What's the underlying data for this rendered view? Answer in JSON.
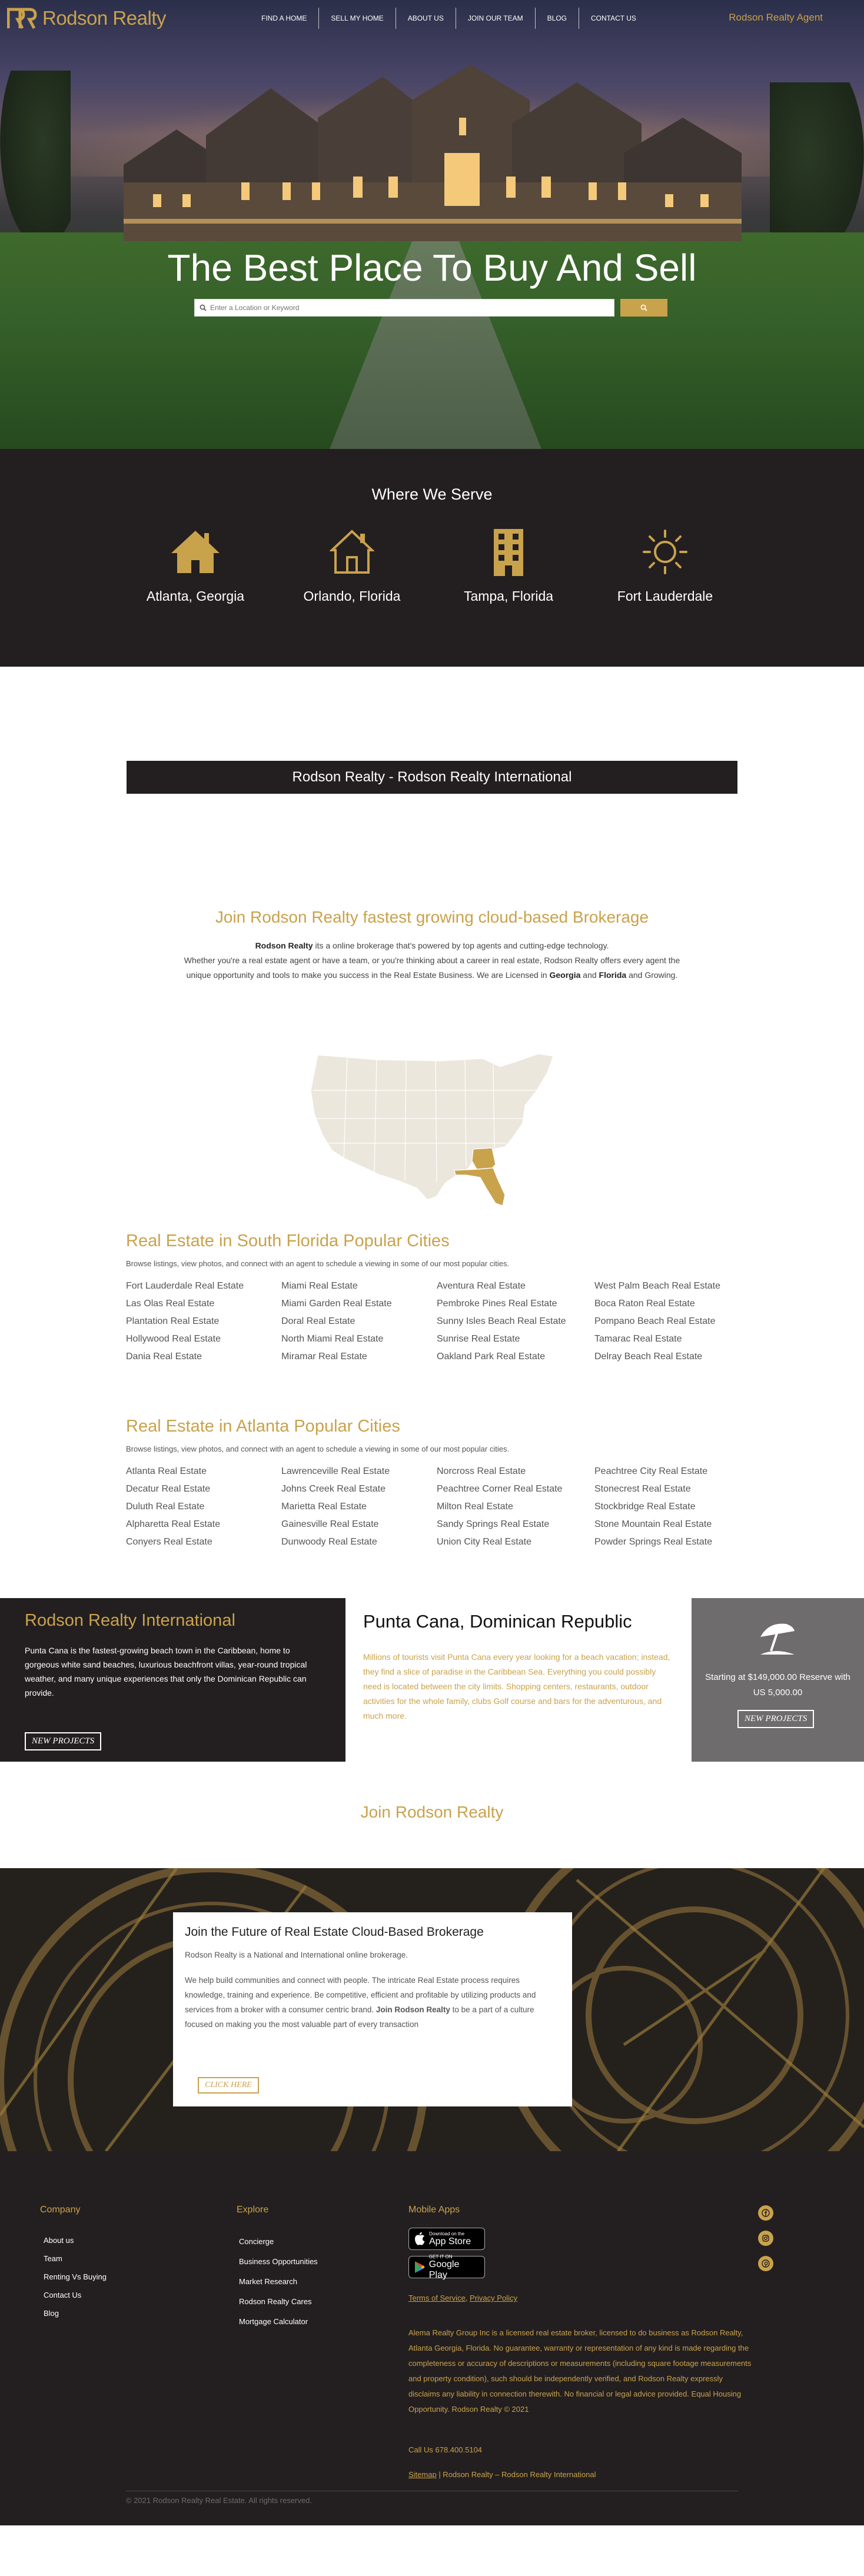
{
  "brand": {
    "name": "Rodson Realty",
    "accent": "#c9a24c",
    "dark": "#231f20",
    "grey": "#6e6c6d"
  },
  "nav": {
    "items": [
      "FIND A HOME",
      "SELL MY HOME",
      "ABOUT US",
      "JOIN OUR TEAM",
      "BLOG",
      "CONTACT US"
    ],
    "agent_link": "Rodson Realty Agent"
  },
  "hero": {
    "title": "The Best Place To Buy And Sell",
    "search_placeholder": "Enter a Location or Keyword"
  },
  "serve": {
    "heading": "Where We Serve",
    "cities": [
      {
        "label": "Atlanta, Georgia",
        "icon": "house-icon"
      },
      {
        "label": "Orlando, Florida",
        "icon": "house-outline-icon"
      },
      {
        "label": "Tampa, Florida",
        "icon": "building-icon"
      },
      {
        "label": "Fort Lauderdale",
        "icon": "sun-icon"
      }
    ]
  },
  "banner": {
    "text": "Rodson Realty - Rodson Realty International"
  },
  "join_brokerage": {
    "heading": "Join Rodson Realty fastest growing cloud-based Brokerage",
    "line1_bold": "Rodson Realty",
    "line1_rest": " its a online brokerage that's powered by top agents and cutting-edge technology.",
    "line2": "Whether you're a real estate agent or have a team, or you're thinking about a career in real estate, Rodson Realty offers every agent the",
    "line3_a": "unique opportunity and tools to make you success in the Real Estate Business. We are Licensed in ",
    "line3_b": "Georgia",
    "line3_c": " and ",
    "line3_d": "Florida",
    "line3_e": " and Growing."
  },
  "south_florida": {
    "heading": "Real Estate in South Florida Popular Cities",
    "desc": "Browse listings, view photos, and connect with an agent to schedule a viewing in some of our most popular cities.",
    "cities": [
      "Fort Lauderdale Real Estate",
      "Miami Real Estate",
      "Aventura Real Estate",
      "West Palm Beach Real Estate",
      "Las Olas Real Estate",
      "Miami Garden Real Estate",
      "Pembroke Pines Real Estate",
      "Boca Raton Real Estate",
      "Plantation Real Estate",
      "Doral Real Estate",
      "Sunny Isles Beach Real Estate",
      "Pompano Beach Real Estate",
      "Hollywood Real Estate",
      "North Miami Real Estate",
      "Sunrise Real Estate",
      "Tamarac Real Estate",
      "Dania Real Estate",
      "Miramar Real Estate",
      "Oakland Park Real Estate",
      "Delray Beach Real Estate"
    ]
  },
  "atlanta": {
    "heading": "Real Estate in Atlanta Popular Cities",
    "desc": "Browse listings, view photos, and connect with an agent to schedule a viewing in some of our most popular cities.",
    "cities": [
      "Atlanta Real Estate",
      "Lawrenceville Real Estate",
      "Norcross Real Estate",
      "Peachtree City Real Estate",
      "Decatur Real Estate",
      "Johns Creek Real Estate",
      "Peachtree Corner Real Estate",
      "Stonecrest Real Estate",
      "Duluth Real Estate",
      "Marietta Real Estate",
      "Milton Real Estate",
      "Stockbridge Real Estate",
      "Alpharetta Real Estate",
      "Gainesville Real Estate",
      "Sandy Springs Real Estate",
      "Stone Mountain Real Estate",
      "Conyers Real Estate",
      "Dunwoody Real Estate",
      "Union City Real Estate",
      "Powder Springs Real Estate"
    ]
  },
  "international": {
    "heading": "Rodson Realty International",
    "text": "Punta Cana is the fastest-growing beach town in the Caribbean, home to gorgeous white sand beaches, luxurious beachfront villas, year-round tropical weather, and many unique experiences that only the Dominican Republic can provide.",
    "button": "NEW PROJECTS",
    "mid_heading": "Punta Cana, Dominican Republic",
    "mid_text": "Millions of tourists visit  Punta Cana every year looking for a beach vacation; instead, they find a slice of paradise in the Caribbean Sea. Everything you could possibly need is located between the city limits. Shopping centers, restaurants, outdoor activities for the whole family, clubs Golf course and bars for the adventurous, and much more.",
    "price_line1": "Starting at $149,000.00 Reserve with",
    "price_line2": "US 5,000.00",
    "right_button": "NEW PROJECTS"
  },
  "join_rr": {
    "heading": "Join Rodson Realty"
  },
  "future_card": {
    "heading": "Join the Future of Real Estate Cloud-Based Brokerage",
    "p1": "Rodson Realty is a National and International online brokerage.",
    "p2_a": "We help build communities and connect with people. The intricate Real Estate process requires knowledge, training and experience. Be competitive, efficient and profitable by utilizing products and services from a broker with a consumer centric brand. ",
    "p2_b": "Join Rodson Realty",
    "p2_c": " to be a part of a culture focused on making you the most valuable part of every transaction",
    "button": "CLICK HERE"
  },
  "footer": {
    "company_heading": "Company",
    "company_links": [
      "About us",
      "Team",
      "Renting Vs Buying",
      "Contact Us",
      "Blog"
    ],
    "explore_heading": "Explore",
    "explore_links": [
      "Concierge",
      "Business Opportunities",
      "Market Research",
      "Rodson Realty Cares",
      "Mortgage Calculator"
    ],
    "apps_heading": "Mobile Apps",
    "appstore_small": "Download on the",
    "appstore_big": "App Store",
    "googleplay_small": "GET IT ON",
    "googleplay_big": "Google Play",
    "terms": "Terms of Service",
    "terms_sep": ", ",
    "privacy": "Privacy Policy",
    "legal": "Alema Realty Group Inc is a licensed real estate broker, licensed to do business as Rodson Realty, Atlanta Georgia, Florida. No guarantee, warranty or representation of any kind is made regarding the completeness or accuracy of descriptions or measurements (including square footage measurements and property condition), such should be independently verified, and Rodson Realty expressly disclaims any liability in connection therewith. No financial or legal advice provided. Equal Housing Opportunity. Rodson Realty © 2021",
    "phone": "Call Us 678.400.5104",
    "sitemap": "Sitemap",
    "sitemap_rest": " | Rodson Realty – Rodson Realty International",
    "copyright": "© 2021 Rodson Realty Real Estate. All rights reserved.",
    "social_icons": [
      "facebook-icon",
      "instagram-icon",
      "pinterest-icon"
    ]
  }
}
